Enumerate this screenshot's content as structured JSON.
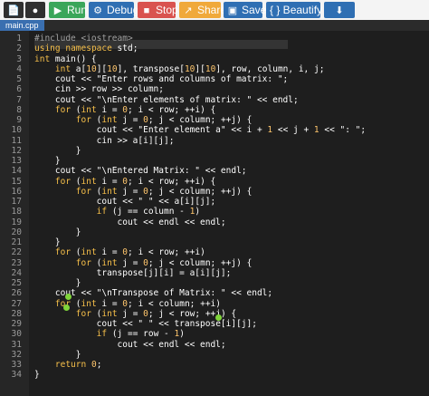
{
  "toolbar": {
    "buttons": [
      {
        "name": "new-file-button",
        "icon": "file-icon",
        "label": "",
        "color": "#2f2f2f"
      },
      {
        "name": "github-button",
        "icon": "github-icon",
        "label": "",
        "color": "#2f2f2f"
      },
      {
        "name": "run-button",
        "icon": "play-icon",
        "label": "Run",
        "color": "#3aa65a"
      },
      {
        "name": "debug-button",
        "icon": "debug-icon",
        "label": "Debug",
        "color": "#2f6fb3"
      },
      {
        "name": "stop-button",
        "icon": "stop-icon",
        "label": "Stop",
        "color": "#d9534f"
      },
      {
        "name": "share-button",
        "icon": "share-icon",
        "label": "Share",
        "color": "#f0a93a"
      },
      {
        "name": "save-button",
        "icon": "save-icon",
        "label": "Save",
        "color": "#2f6fb3"
      },
      {
        "name": "beautify-button",
        "icon": "braces-icon",
        "label": "{ } Beautify",
        "color": "#2f6fb3"
      },
      {
        "name": "download-button",
        "icon": "download-icon",
        "label": "",
        "color": "#2f6fb3"
      }
    ]
  },
  "tabs": [
    {
      "label": "main.cpp"
    }
  ],
  "lines": [
    "#include <iostream>",
    "using namespace std;",
    "int main() {",
    "    int a[10][10], transpose[10][10], row, column, i, j;",
    "    cout << \"Enter rows and columns of matrix: \";",
    "    cin >> row >> column;",
    "    cout << \"\\nEnter elements of matrix: \" << endl;",
    "    for (int i = 0; i < row; ++i) {",
    "        for (int j = 0; j < column; ++j) {",
    "            cout << \"Enter element a\" << i + 1 << j + 1 << \": \";",
    "            cin >> a[i][j];",
    "        }",
    "    }",
    "    cout << \"\\nEntered Matrix: \" << endl;",
    "    for (int i = 0; i < row; ++i) {",
    "        for (int j = 0; j < column; ++j) {",
    "            cout << \" \" << a[i][j];",
    "            if (j == column - 1)",
    "                cout << endl << endl;",
    "        }",
    "    }",
    "    for (int i = 0; i < row; ++i)",
    "        for (int j = 0; j < column; ++j) {",
    "            transpose[j][i] = a[i][j];",
    "        }",
    "    cout << \"\\nTranspose of Matrix: \" << endl;",
    "    for (int i = 0; i < column; ++i)",
    "        for (int j = 0; j < row; ++j) {",
    "            cout << \" \" << transpose[i][j];",
    "            if (j == row - 1)",
    "                cout << endl << endl;",
    "        }",
    "    return 0;",
    "}"
  ],
  "selected_line": 1,
  "colors": {
    "keyword": "#f7c04a",
    "preprocessor": "#a0a0a0",
    "number": "#ffc66d",
    "breakpoint": "#7fd43a"
  }
}
